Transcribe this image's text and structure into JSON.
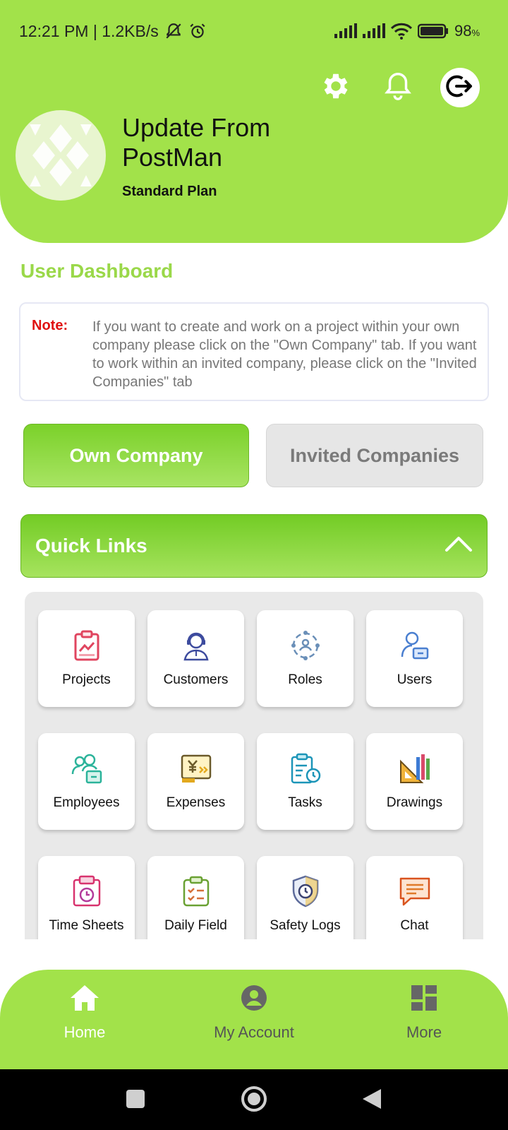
{
  "status_bar": {
    "time_speed": "12:21 PM | 1.2KB/s",
    "battery": "98",
    "battery_unit": "%"
  },
  "header": {
    "user_name": "Update From PostMan",
    "plan": "Standard Plan",
    "icons": [
      "gear-icon",
      "bell-icon",
      "logout-icon"
    ]
  },
  "dashboard": {
    "title": "User Dashboard",
    "note_label": "Note:",
    "note_text": "If you want to create and work on a project within your own company please click on the \"Own Company\" tab. If you want to work within an invited company, please click on the \"Invited Companies\" tab"
  },
  "tabs": {
    "own": "Own Company",
    "invited": "Invited Companies",
    "active": "own"
  },
  "quick_links": {
    "title": "Quick Links",
    "items": [
      {
        "label": "Projects",
        "icon": "projects-icon"
      },
      {
        "label": "Customers",
        "icon": "customers-icon"
      },
      {
        "label": "Roles",
        "icon": "roles-icon"
      },
      {
        "label": "Users",
        "icon": "users-icon"
      },
      {
        "label": "Employees",
        "icon": "employees-icon"
      },
      {
        "label": "Expenses",
        "icon": "expenses-icon"
      },
      {
        "label": "Tasks",
        "icon": "tasks-icon"
      },
      {
        "label": "Drawings",
        "icon": "drawings-icon"
      },
      {
        "label": "Time Sheets",
        "icon": "time-sheets-icon"
      },
      {
        "label": "Daily Field",
        "icon": "daily-field-icon"
      },
      {
        "label": "Safety Logs",
        "icon": "safety-logs-icon"
      },
      {
        "label": "Chat",
        "icon": "chat-icon"
      }
    ]
  },
  "bottom_nav": {
    "home": "Home",
    "account": "My Account",
    "more": "More",
    "active": "home"
  },
  "colors": {
    "brand_green": "#a2e24a",
    "accent_green": "#9ad849",
    "note_red": "#e01010"
  }
}
